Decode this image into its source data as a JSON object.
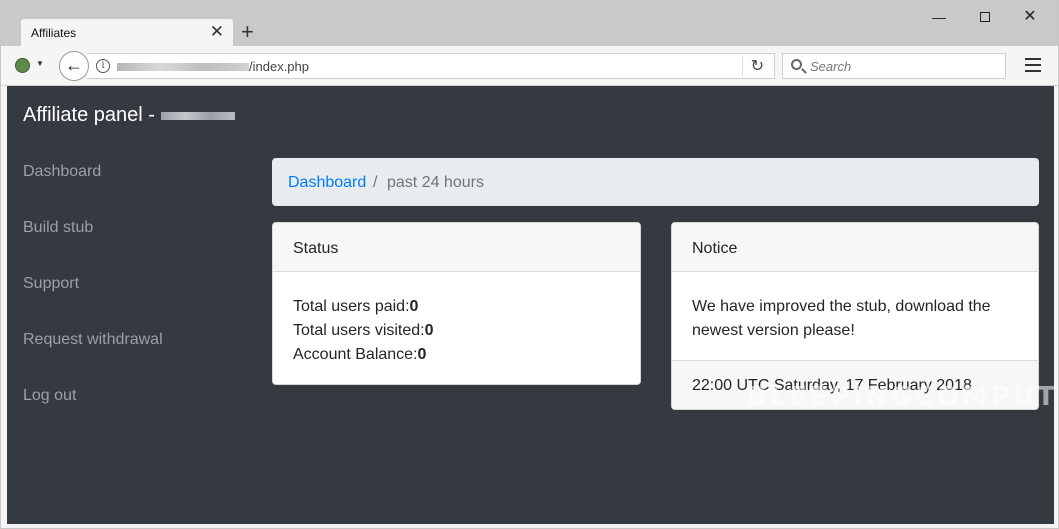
{
  "browser": {
    "tab_title": "Affiliates",
    "tab_close": "✕",
    "new_tab": "+",
    "url_suffix": "/index.php",
    "search_placeholder": "Search",
    "reload_glyph": "↻",
    "back_glyph": "←",
    "window_min": "—",
    "window_close": "✕"
  },
  "app": {
    "brand": "Affiliate panel - "
  },
  "sidebar": {
    "items": [
      {
        "label": "Dashboard"
      },
      {
        "label": "Build stub"
      },
      {
        "label": "Support"
      },
      {
        "label": "Request withdrawal"
      },
      {
        "label": "Log out"
      }
    ]
  },
  "breadcrumb": {
    "root": "Dashboard",
    "separator": "/",
    "current": "past 24 hours"
  },
  "status_card": {
    "title": "Status",
    "rows": [
      {
        "label": "Total users paid:",
        "value": "0"
      },
      {
        "label": "Total users visited:",
        "value": "0"
      },
      {
        "label": "Account Balance:",
        "value": "0"
      }
    ]
  },
  "notice_card": {
    "title": "Notice",
    "message_line1": "We have improved the stub, download the",
    "message_line2": "newest version please!",
    "footer": "22:00 UTC Saturday, 17 February 2018"
  },
  "watermark": "BLEEPINGCOMPUTER",
  "icons": {
    "tor": "tor-onion-icon",
    "info": "info-icon",
    "search": "search-icon",
    "menu": "hamburger-menu-icon"
  },
  "colors": {
    "page_bg": "#343a40",
    "link": "#007bff",
    "sidebar_text": "#9aa0a6",
    "breadcrumb_bg": "#e9ecef"
  }
}
